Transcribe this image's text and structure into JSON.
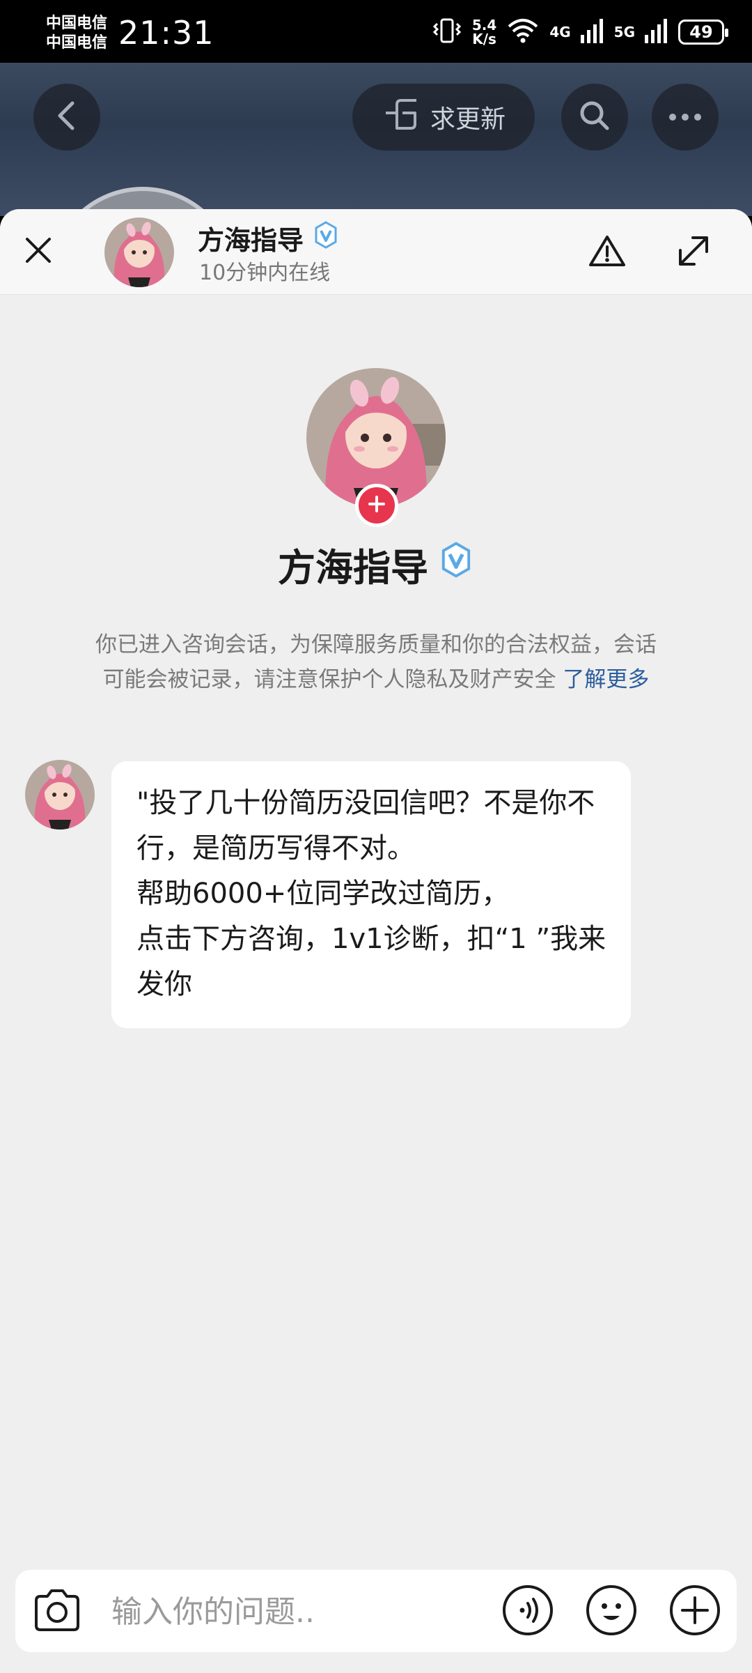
{
  "status_bar": {
    "carrier_1": "中国电信",
    "carrier_2": "中国电信",
    "time": "21:31",
    "speed_value": "5.4",
    "speed_unit": "K/s",
    "net_1": "4G",
    "net_2": "5G",
    "battery": "49"
  },
  "background_page": {
    "request_update_label": "求更新"
  },
  "header": {
    "name": "方海指导",
    "status": "10分钟内在线"
  },
  "profile": {
    "name": "方海指导"
  },
  "notice": {
    "text": "你已进入咨询会话，为保障服务质量和你的合法权益，会话可能会被记录，请注意保护个人隐私及财产安全",
    "link": "了解更多"
  },
  "messages": [
    {
      "sender": "方海指导",
      "text": "\"投了几十份简历没回信吧？不是你不行，是简历写得不对。\n帮助6000+位同学改过简历，\n点击下方咨询，1v1诊断，扣“1 ”我来发你"
    }
  ],
  "input": {
    "placeholder": "输入你的问题.."
  },
  "colors": {
    "accent_red": "#e8354e",
    "link_blue": "#2b5d9e",
    "verified_blue": "#5aa9e6"
  }
}
